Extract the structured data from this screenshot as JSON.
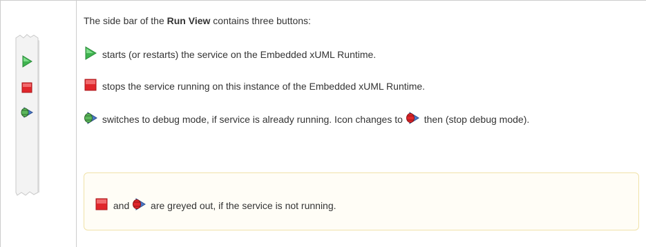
{
  "intro": {
    "prefix": "The side bar of the ",
    "bold": "Run View",
    "suffix": " contains three buttons:"
  },
  "items": [
    {
      "icon": "play-icon",
      "text": " starts (or restarts) the service on the Embedded xUML Runtime."
    },
    {
      "icon": "stop-icon",
      "text": " stops the service running on this instance of the Embedded xUML Runtime."
    },
    {
      "icon": "debug-icon",
      "text_a": " switches to debug mode, if service is already running. Icon changes to ",
      "text_b": " then (stop debug mode)."
    }
  ],
  "note": {
    "word_and": " and ",
    "tail": " are greyed out, if the service is not running."
  },
  "colors": {
    "play_green": "#3fb34f",
    "stop_red": "#e0262b",
    "debug_blue": "#4a78c8",
    "note_bg": "#fffdf6",
    "note_border": "#f0e2a8"
  }
}
